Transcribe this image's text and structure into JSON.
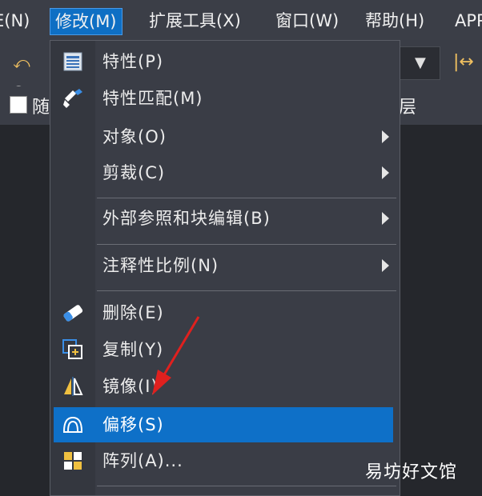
{
  "menubar": {
    "items": [
      {
        "label": "E(N)"
      },
      {
        "label": "修改(M)"
      },
      {
        "label": "扩展工具(X)"
      },
      {
        "label": "窗口(W)"
      },
      {
        "label": "帮助(H)"
      },
      {
        "label": "APP"
      }
    ]
  },
  "toolbar2": {
    "left_label": "随",
    "right_label": "层"
  },
  "menu": {
    "items": [
      {
        "label": "特性(P)",
        "icon": "properties-icon",
        "submenu": false
      },
      {
        "label": "特性匹配(M)",
        "icon": "match-properties-brush-icon",
        "submenu": false
      },
      {
        "label": "对象(O)",
        "icon": "",
        "submenu": true
      },
      {
        "label": "剪裁(C)",
        "icon": "",
        "submenu": true
      },
      {
        "label": "外部参照和块编辑(B)",
        "icon": "",
        "submenu": true
      },
      {
        "label": "注释性比例(N)",
        "icon": "",
        "submenu": true
      },
      {
        "label": "删除(E)",
        "icon": "eraser-icon",
        "submenu": false
      },
      {
        "label": "复制(Y)",
        "icon": "copy-icon",
        "submenu": false
      },
      {
        "label": "镜像(I)",
        "icon": "mirror-icon",
        "submenu": false
      },
      {
        "label": "偏移(S)",
        "icon": "offset-icon",
        "submenu": false
      },
      {
        "label": "阵列(A)...",
        "icon": "array-icon",
        "submenu": false
      }
    ],
    "highlighted": "偏移(S)"
  },
  "watermark": "易坊好文馆",
  "colors": {
    "highlight": "#0e70c8",
    "menu_bg": "#3a3d46",
    "arrow": "#e0201e"
  }
}
